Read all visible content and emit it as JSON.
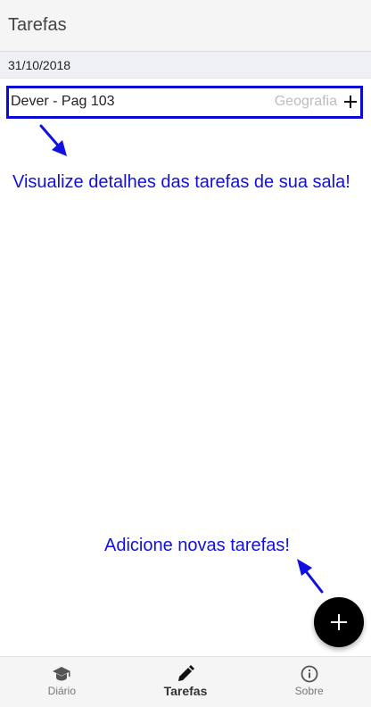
{
  "header": {
    "title": "Tarefas"
  },
  "section": {
    "date": "31/10/2018"
  },
  "tasks": [
    {
      "title": "Dever - Pag 103",
      "subject": "Geografia",
      "expand_icon": "plus-icon"
    }
  ],
  "annotations": {
    "details_hint": "Visualize detalhes das tarefas de sua sala!",
    "add_hint": "Adicione novas tarefas!",
    "color": "#1010e0",
    "highlight_color": "#0a0ad6"
  },
  "fab": {
    "icon": "plus-icon",
    "color": "#000000"
  },
  "bottom_nav": {
    "items": [
      {
        "label": "Diário",
        "icon": "school-icon",
        "active": false
      },
      {
        "label": "Tarefas",
        "icon": "pencil-icon",
        "active": true
      },
      {
        "label": "Sobre",
        "icon": "info-icon",
        "active": false
      }
    ]
  }
}
